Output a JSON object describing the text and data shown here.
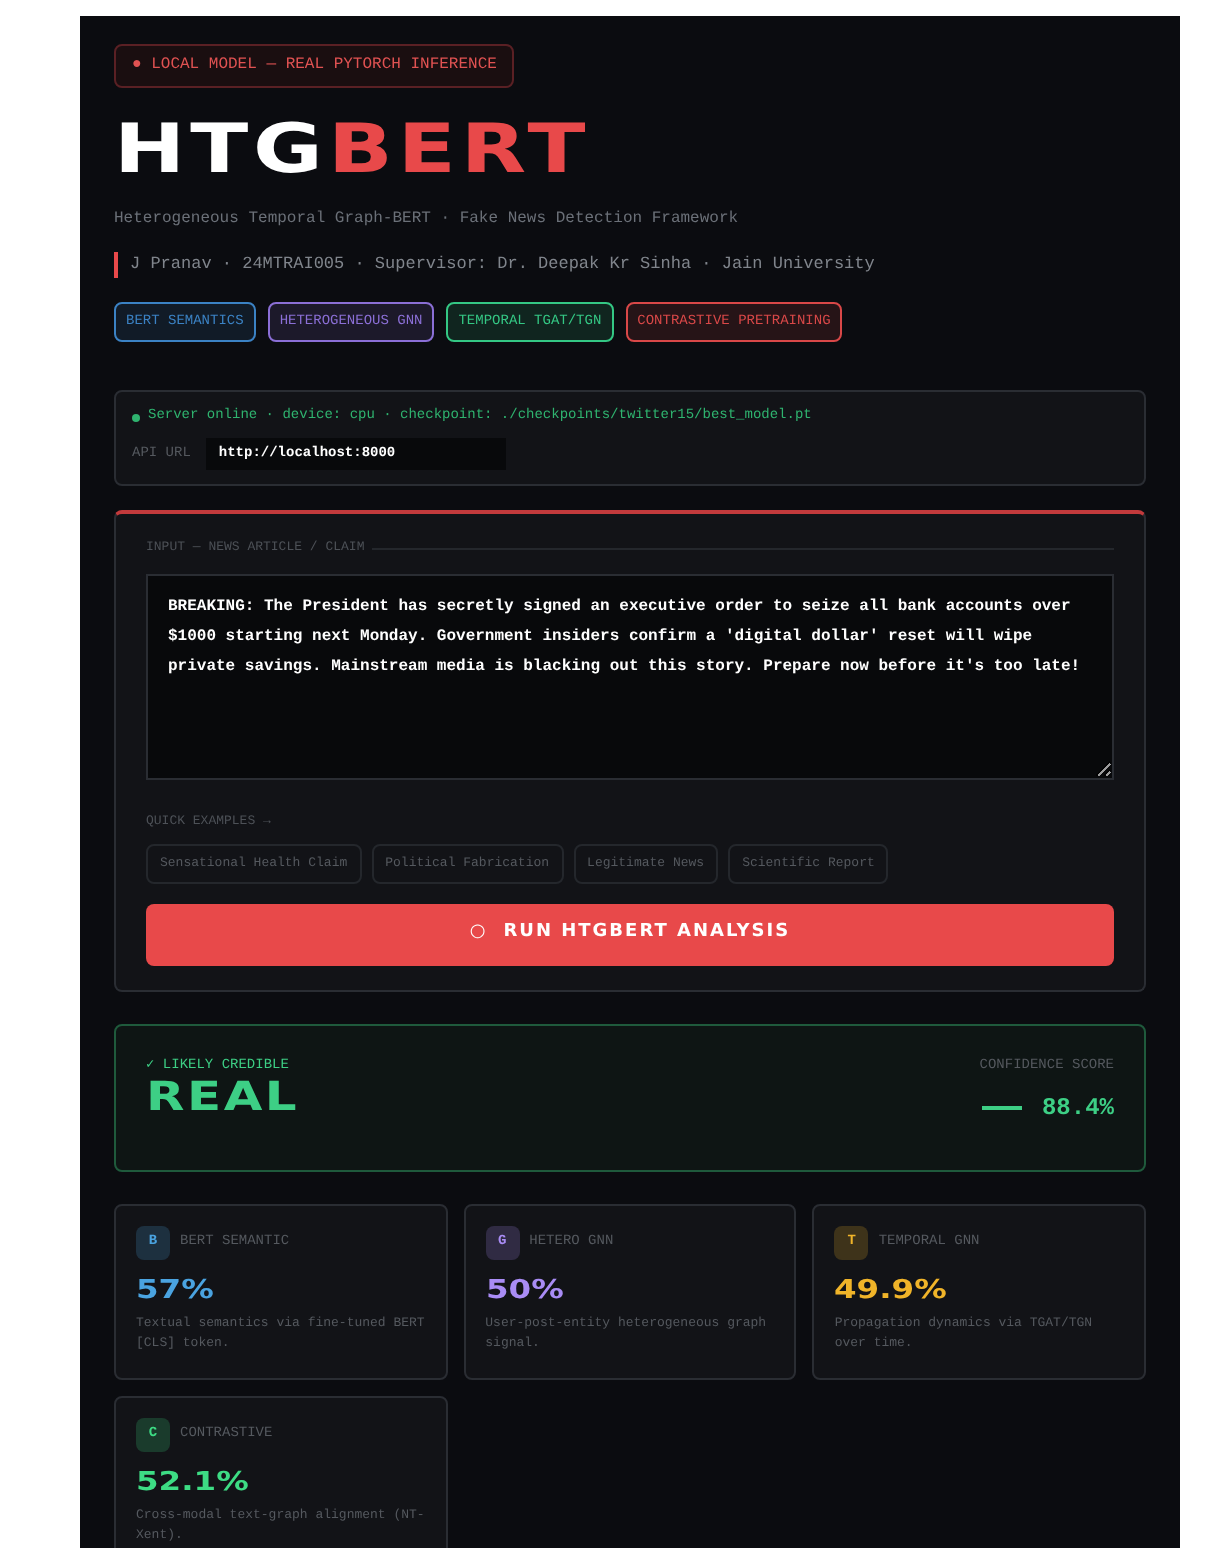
{
  "header": {
    "badge": "● LOCAL MODEL — REAL PYTORCH INFERENCE",
    "title_part1": "HTG",
    "title_part2": "BERT",
    "subtitle": "Heterogeneous Temporal Graph-BERT · Fake News Detection Framework",
    "author": "J Pranav · 24MTRAI005 · Supervisor: Dr. Deepak Kr Sinha · Jain University",
    "tags": [
      {
        "label": "BERT SEMANTICS",
        "color": "#3b82c4"
      },
      {
        "label": "HETEROGENEOUS GNN",
        "color": "#8b6fd6"
      },
      {
        "label": "TEMPORAL TGAT/TGN",
        "color": "#34c784"
      },
      {
        "label": "CONTRASTIVE PRETRAINING",
        "color": "#d94848"
      }
    ]
  },
  "server": {
    "online": true,
    "status": "Server online · device: cpu · checkpoint: ./checkpoints/twitter15/best_model.pt",
    "api_label": "API URL",
    "api_url": "http://localhost:8000"
  },
  "input": {
    "legend": "INPUT — NEWS ARTICLE / CLAIM",
    "text": "BREAKING: The President has secretly signed an executive order to seize all bank accounts over $1000 starting next Monday. Government insiders confirm a 'digital dollar' reset will wipe private savings. Mainstream media is blacking out this story. Prepare now before it's too late!",
    "examples_label": "QUICK EXAMPLES →",
    "examples": [
      "Sensational Health Claim",
      "Political Fabrication",
      "Legitimate News",
      "Scientific Report"
    ],
    "run_icon": "○",
    "run_button": "RUN HTGBERT ANALYSIS"
  },
  "result": {
    "label": "✓ LIKELY CREDIBLE",
    "verdict": "REAL",
    "score_label": "CONFIDENCE SCORE",
    "score": "88.4%"
  },
  "metrics": [
    {
      "letter": "B",
      "name": "BERT SEMANTIC",
      "value": "57%",
      "desc": "Textual semantics via fine-tuned BERT [CLS] token.",
      "color": "#4aa3e0"
    },
    {
      "letter": "G",
      "name": "HETERO GNN",
      "value": "50%",
      "desc": "User-post-entity heterogeneous graph signal.",
      "color": "#a98cf5"
    },
    {
      "letter": "T",
      "name": "TEMPORAL GNN",
      "value": "49.9%",
      "desc": "Propagation dynamics via TGAT/TGN over time.",
      "color": "#f0b429"
    },
    {
      "letter": "C",
      "name": "CONTRASTIVE",
      "value": "52.1%",
      "desc": "Cross-modal text-graph alignment (NT-Xent).",
      "color": "#3ddc84"
    }
  ]
}
